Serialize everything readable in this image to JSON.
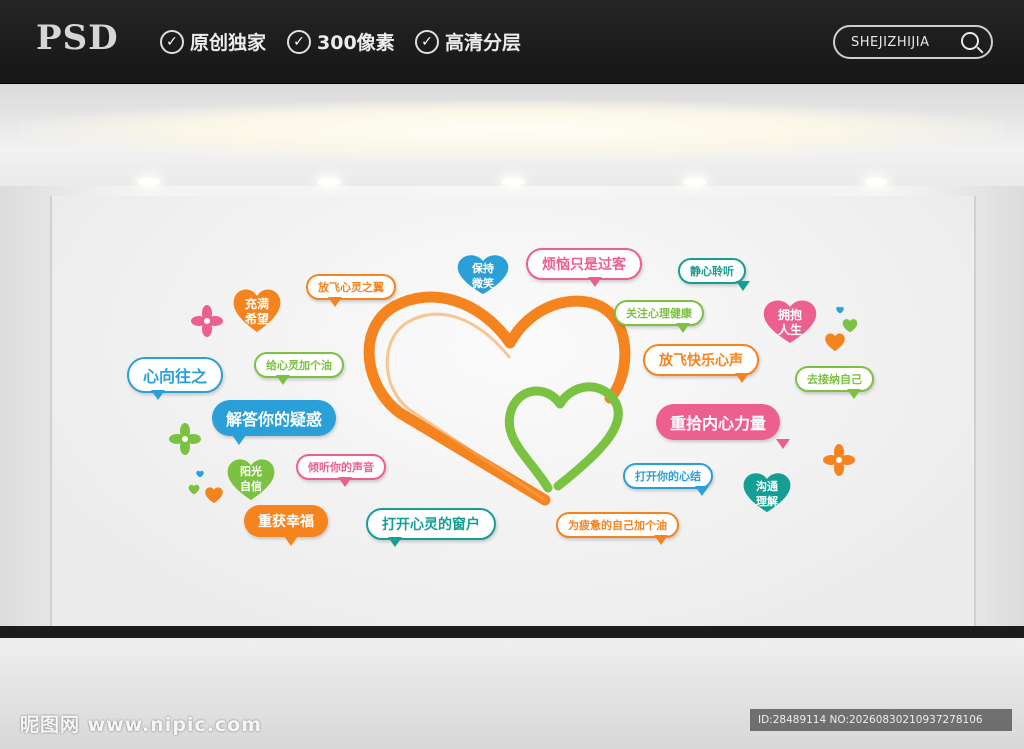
{
  "header": {
    "logo": "PSD",
    "badges": [
      "原创独家",
      "300像素",
      "高清分层"
    ],
    "search_label": "SHEJIZHIJIA"
  },
  "bubbles": {
    "fangfei_xinling": "放飞心灵之翼",
    "xiang_wang": "心向往之",
    "gei_xinling": "给心灵加个油",
    "jieda": "解答你的疑惑",
    "qingting": "倾听你的声音",
    "chongshi_xingfu": "重获幸福",
    "dakai_chuanghu": "打开心灵的窗户",
    "fannao": "烦恼只是过客",
    "jingxin": "静心聆听",
    "guanzhu": "关注心理健康",
    "fangfei_kuaile": "放飞快乐心声",
    "jienazi": "去接纳自己",
    "chongshi_liliang": "重拾内心力量",
    "dakai_xinjie": "打开你的心结",
    "pijuan": "为疲惫的自己加个油"
  },
  "hearts": {
    "chongman": [
      "充满",
      "希望"
    ],
    "baochi": [
      "保持",
      "微笑"
    ],
    "yongbao": [
      "拥抱",
      "人生"
    ],
    "yangguang": [
      "阳光",
      "自信"
    ],
    "goutong": [
      "沟通",
      "理解"
    ]
  },
  "colors": {
    "orange": "#f5841f",
    "green": "#7cc242",
    "blue": "#2a9fd8",
    "pink": "#ec5f8f",
    "teal": "#159e93"
  },
  "footer": {
    "watermark": "昵图网 www.nipic.com",
    "id_text": "ID:28489114 NO:20260830210937278106"
  }
}
